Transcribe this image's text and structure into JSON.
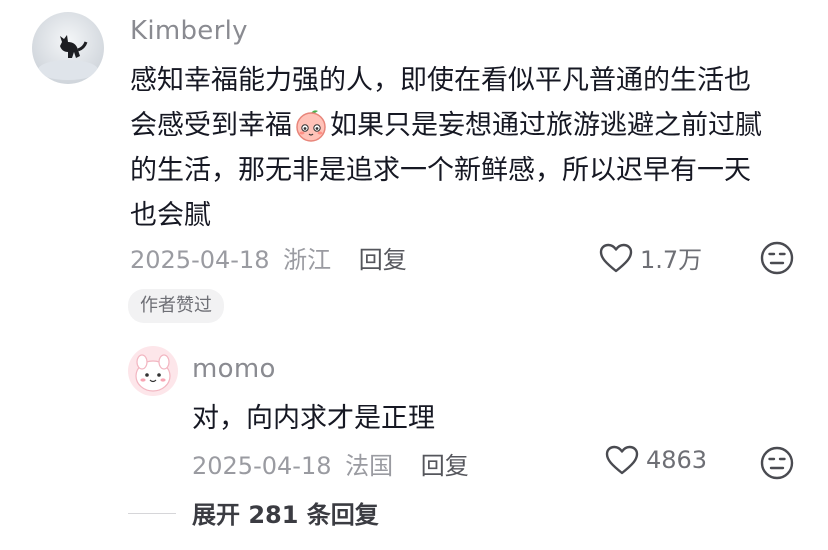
{
  "comment": {
    "username": "Kimberly",
    "text_line1": "感知幸福能力强的人，即使在看似平凡普通的生活也",
    "text_line2_a": "会感受到幸福",
    "text_line2_b": "如果只是妄想通过旅游逃避之前过腻",
    "text_line3": "的生活，那无非是追求一个新鲜感，所以迟早有一天",
    "text_line4": "也会腻",
    "emoji": "peach-blushing-face-emoji",
    "date": "2025-04-18",
    "location": "浙江",
    "reply_label": "回复",
    "like_count": "1.7万",
    "badge": "作者赞过"
  },
  "reply": {
    "username": "momo",
    "text": "对，向内求才是正理",
    "date": "2025-04-18",
    "location": "法国",
    "reply_label": "回复",
    "like_count": "4863"
  },
  "expand_label": "展开 281 条回复",
  "icons": {
    "like": "heart-outline-icon",
    "dislike": "meh-face-icon"
  },
  "colors": {
    "username": "#8a8b91",
    "text": "#161823",
    "meta": "#9a9ba1",
    "tag_bg": "#f2f2f3"
  }
}
